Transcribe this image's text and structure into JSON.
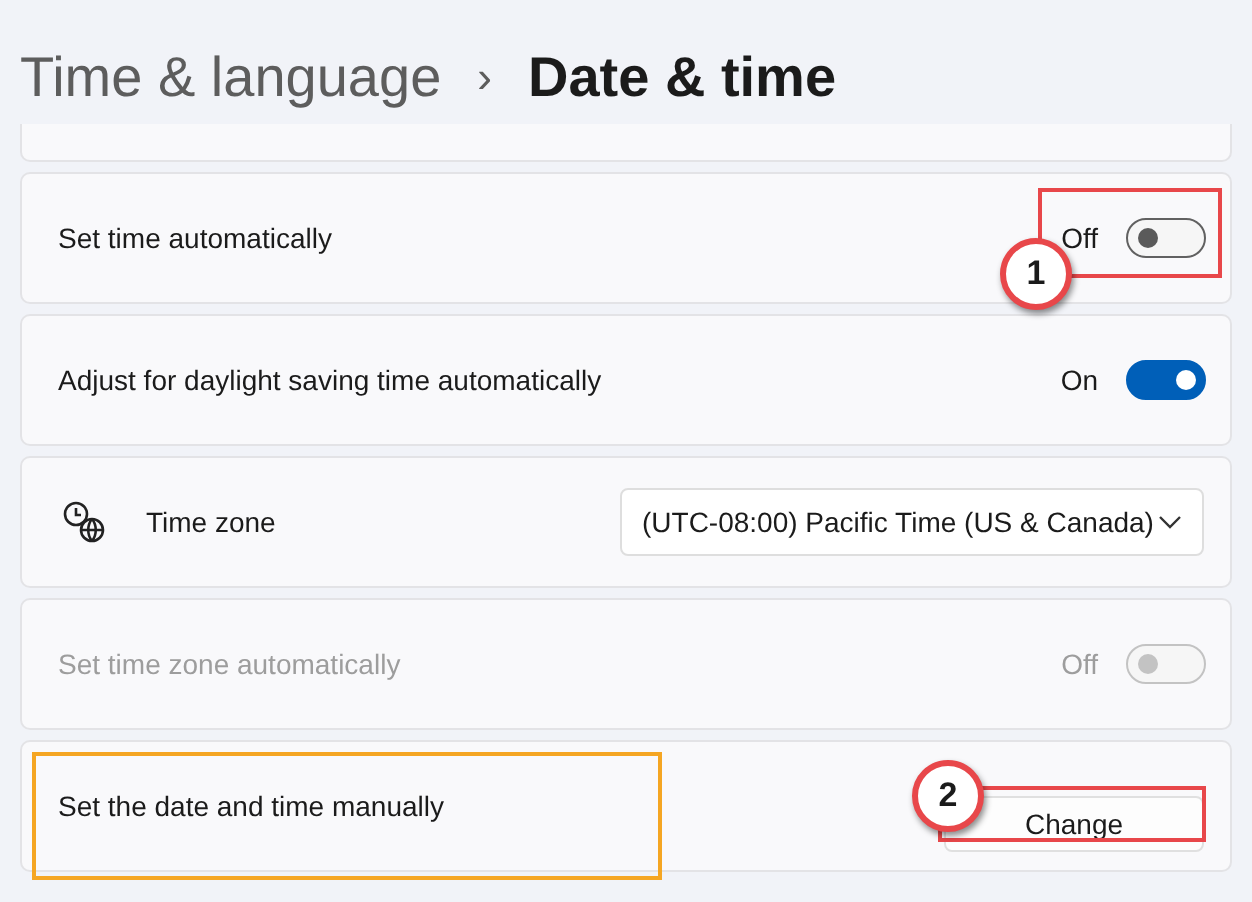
{
  "breadcrumb": {
    "parent": "Time & language",
    "separator": "›",
    "current": "Date & time"
  },
  "settings": [
    {
      "kind": "toggle",
      "label": "Set time automatically",
      "state_text": "Off",
      "on": false,
      "disabled": false
    },
    {
      "kind": "toggle",
      "label": "Adjust for daylight saving time automatically",
      "state_text": "On",
      "on": true,
      "disabled": false
    },
    {
      "kind": "dropdown",
      "label": "Time zone",
      "value": "(UTC-08:00) Pacific Time (US & Canada)"
    },
    {
      "kind": "toggle",
      "label": "Set time zone automatically",
      "state_text": "Off",
      "on": false,
      "disabled": true
    },
    {
      "kind": "button",
      "label": "Set the date and time manually",
      "button": "Change"
    }
  ],
  "annotations": [
    {
      "kind": "box",
      "color": "#e8474a"
    },
    {
      "kind": "callout",
      "label": "1",
      "color": "#e8474a"
    },
    {
      "kind": "box",
      "color": "#f5a623"
    },
    {
      "kind": "box",
      "color": "#e8474a"
    },
    {
      "kind": "callout",
      "label": "2",
      "color": "#e8474a"
    }
  ]
}
